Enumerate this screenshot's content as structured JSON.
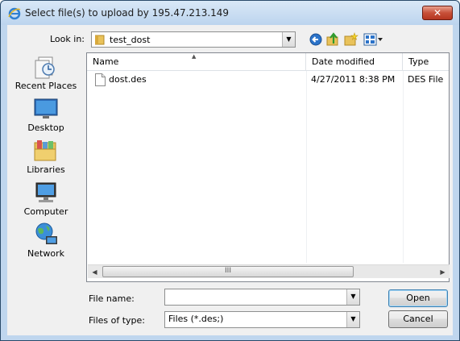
{
  "window": {
    "title": "Select file(s) to upload by 195.47.213.149",
    "close_label": "✕"
  },
  "toolbar": {
    "look_in_label": "Look in:",
    "look_in_value": "test_dost",
    "icons": [
      "back-icon",
      "up-folder-icon",
      "new-folder-icon",
      "view-menu-icon"
    ]
  },
  "places": [
    {
      "label": "Recent Places",
      "icon": "recent-places-icon"
    },
    {
      "label": "Desktop",
      "icon": "desktop-icon"
    },
    {
      "label": "Libraries",
      "icon": "libraries-icon"
    },
    {
      "label": "Computer",
      "icon": "computer-icon"
    },
    {
      "label": "Network",
      "icon": "network-icon"
    }
  ],
  "file_list": {
    "columns": [
      "Name",
      "Date modified",
      "Type"
    ],
    "rows": [
      {
        "name": "dost.des",
        "date_modified": "4/27/2011 8:38 PM",
        "type": "DES File"
      }
    ],
    "scroll_thumb_grip": "III"
  },
  "bottom": {
    "file_name_label": "File name:",
    "file_name_value": "",
    "files_of_type_label": "Files of type:",
    "files_of_type_value": "Files (*.des;)",
    "open_label": "Open",
    "cancel_label": "Cancel"
  },
  "colors": {
    "title_bar": "#bcd4ee",
    "close_button": "#c75039",
    "dialog_bg": "#f0f0f0"
  }
}
